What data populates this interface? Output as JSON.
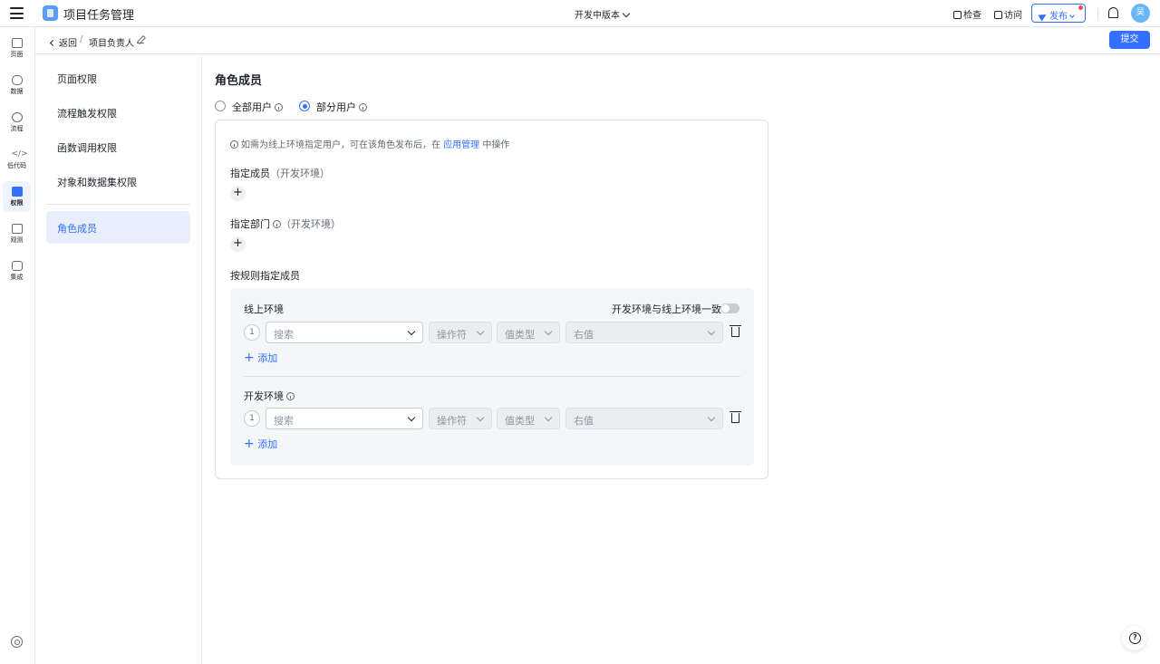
{
  "topbar": {
    "app_name": "项目任务管理",
    "version_label": "开发中版本",
    "inspect_label": "检查",
    "visit_label": "访问",
    "publish_label": "发布",
    "avatar_text": "吴",
    "icons": [
      "menu-icon",
      "app-logo-icon",
      "chevron-down-icon",
      "inspect-icon",
      "visit-icon",
      "send-icon",
      "bell-icon"
    ]
  },
  "leftnav": {
    "items": [
      {
        "label": "页面",
        "icon": "page-icon"
      },
      {
        "label": "数据",
        "icon": "database-icon"
      },
      {
        "label": "流程",
        "icon": "flow-icon"
      },
      {
        "label": "低代码",
        "icon": "code-icon"
      },
      {
        "label": "权限",
        "icon": "briefcase-icon",
        "active": true
      },
      {
        "label": "观测",
        "icon": "monitor-icon"
      },
      {
        "label": "集成",
        "icon": "cube-icon"
      }
    ]
  },
  "subbar": {
    "back_label": "返回",
    "separator": "/",
    "title": "项目负责人",
    "submit_label": "提交"
  },
  "perm_menu": {
    "items": [
      "页面权限",
      "流程触发权限",
      "函数调用权限",
      "对象和数据集权限"
    ],
    "active_item": "角色成员"
  },
  "main": {
    "title": "角色成员",
    "radio_all": "全部用户",
    "radio_partial": "部分用户",
    "selected_radio": "部分用户",
    "hint_prefix": "如需为线上环境指定用户，可在该角色发布后，在",
    "hint_link": "应用管理",
    "hint_suffix": "中操作",
    "assign_members": "指定成员",
    "assign_departments": "指定部门",
    "dev_env_paren": "（开发环境）",
    "rule_title": "按规则指定成员",
    "online_env": "线上环境",
    "sync_toggle_label": "开发环境与线上环境一致",
    "sync_toggle_on": false,
    "dev_env": "开发环境",
    "rule_index": "1",
    "search_placeholder": "搜索",
    "operator_placeholder": "操作符",
    "value_type_placeholder": "值类型",
    "right_value_placeholder": "右值",
    "add_label": "添加",
    "plus_symbol": "+"
  }
}
